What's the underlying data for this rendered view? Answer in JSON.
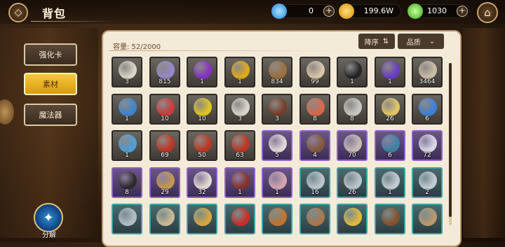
{
  "header": {
    "title": "背包"
  },
  "resources": [
    {
      "name": "blue-gem",
      "value": "0",
      "color": "#3fb3ff"
    },
    {
      "name": "gold-coin",
      "value": "199.6W",
      "color": "#f2b21d"
    },
    {
      "name": "green-crystal",
      "value": "1030",
      "color": "#5fd13b"
    }
  ],
  "tabs": [
    {
      "label": "强化卡",
      "active": false
    },
    {
      "label": "素材",
      "active": true
    },
    {
      "label": "魔法器",
      "active": false
    }
  ],
  "decompose_label": "分解",
  "inventory": {
    "capacity": "容量: 52/2000",
    "sort_label": "降序",
    "sort_icon": "⇅",
    "quality_label": "品质",
    "quality_icon": "⌄",
    "rows": [
      [
        {
          "icon": "feather-icon",
          "rarity": "gray",
          "count": "3",
          "color": "#e9e3d6"
        },
        {
          "icon": "ticket-icon",
          "rarity": "gray",
          "count": "815",
          "color": "#9c8fd8"
        },
        {
          "icon": "purple-feather-icon",
          "rarity": "gray",
          "count": "1",
          "color": "#8b2fd0"
        },
        {
          "icon": "golden-feather-icon",
          "rarity": "gray",
          "count": "1",
          "color": "#f0b418"
        },
        {
          "icon": "potato-icon",
          "rarity": "gray",
          "count": "834",
          "color": "#a5743c"
        },
        {
          "icon": "scroll-icon",
          "rarity": "gray",
          "count": "99",
          "color": "#e8d2b4"
        },
        {
          "icon": "ink-bottle-icon",
          "rarity": "gray",
          "count": "1",
          "color": "#1f1f24"
        },
        {
          "icon": "purple-crystal-icon",
          "rarity": "gray",
          "count": "1",
          "color": "#6a3ad0"
        },
        {
          "icon": "bottle-icon",
          "rarity": "gray",
          "count": "3464",
          "color": "#d8c8b0"
        }
      ],
      [
        {
          "icon": "blue-stars-icon",
          "rarity": "gray",
          "count": "1",
          "color": "#3a8ce0"
        },
        {
          "icon": "red-stars-icon",
          "rarity": "gray",
          "count": "10",
          "color": "#d83a3a"
        },
        {
          "icon": "yellow-stars-icon",
          "rarity": "gray",
          "count": "10",
          "color": "#f0d21c"
        },
        {
          "icon": "teapot-icon",
          "rarity": "gray",
          "count": "3",
          "color": "#e8e2da"
        },
        {
          "icon": "slingshot-icon",
          "rarity": "gray",
          "count": "3",
          "color": "#7a3a24"
        },
        {
          "icon": "cake-icon",
          "rarity": "gray",
          "count": "8",
          "color": "#e86a4a"
        },
        {
          "icon": "jar-icon",
          "rarity": "gray",
          "count": "8",
          "color": "#d6d4d0"
        },
        {
          "icon": "pudding-icon",
          "rarity": "gray",
          "count": "26",
          "color": "#f2d26a"
        },
        {
          "icon": "blue-potion-icon",
          "rarity": "gray",
          "count": "6",
          "color": "#3a86e8"
        }
      ],
      [
        {
          "icon": "potion-vial-icon",
          "rarity": "gray",
          "count": "1",
          "color": "#4aa8e8"
        },
        {
          "icon": "treasure-chest-icon",
          "rarity": "gray",
          "count": "69",
          "color": "#c8321e"
        },
        {
          "icon": "treasure-chest-icon",
          "rarity": "gray",
          "count": "50",
          "color": "#c8321e"
        },
        {
          "icon": "treasure-chest-icon",
          "rarity": "gray",
          "count": "63",
          "color": "#c8321e"
        },
        {
          "icon": "sake-bottle-icon",
          "rarity": "purple",
          "count": "5",
          "color": "#f0e8e0"
        },
        {
          "icon": "wooden-club-icon",
          "rarity": "purple",
          "count": "4",
          "color": "#8a5a34"
        },
        {
          "icon": "flask-icon",
          "rarity": "purple",
          "count": "70",
          "color": "#d4c8bc"
        },
        {
          "icon": "book-icon",
          "rarity": "purple",
          "count": "6",
          "color": "#3a8aa8"
        },
        {
          "icon": "ribbon-icon",
          "rarity": "purple",
          "count": "72",
          "color": "#e8e8f4"
        }
      ],
      [
        {
          "icon": "black-book-icon",
          "rarity": "purple",
          "count": "8",
          "color": "#2a2624"
        },
        {
          "icon": "sandwich-icon",
          "rarity": "purple",
          "count": "29",
          "color": "#d0a050"
        },
        {
          "icon": "milk-jar-icon",
          "rarity": "purple",
          "count": "32",
          "color": "#f0eadc"
        },
        {
          "icon": "meat-icon",
          "rarity": "purple",
          "count": "1",
          "color": "#8a3024"
        },
        {
          "icon": "letter-icon",
          "rarity": "purple",
          "count": "1",
          "color": "#e0b0b4"
        },
        {
          "icon": "silver-staff-icon",
          "rarity": "teal",
          "count": "16",
          "color": "#c8d0d8"
        },
        {
          "icon": "silver-staff-icon",
          "rarity": "teal",
          "count": "26",
          "color": "#c8d0d8"
        },
        {
          "icon": "silver-wand-icon",
          "rarity": "teal",
          "count": "1",
          "color": "#d0d8e0"
        },
        {
          "icon": "silver-scepter-icon",
          "rarity": "teal",
          "count": "2",
          "color": "#d0d8e0"
        }
      ],
      [
        {
          "icon": "silver-key-icon",
          "rarity": "teal",
          "count": "",
          "color": "#c0c8d0"
        },
        {
          "icon": "parchment-icon",
          "rarity": "teal",
          "count": "",
          "color": "#d8c49a"
        },
        {
          "icon": "flower-bouquet-icon",
          "rarity": "teal",
          "count": "",
          "color": "#e8b040"
        },
        {
          "icon": "apple-icon",
          "rarity": "teal",
          "count": "",
          "color": "#d82a24"
        },
        {
          "icon": "bread-icon",
          "rarity": "teal",
          "count": "",
          "color": "#d0782c"
        },
        {
          "icon": "mushroom-icon",
          "rarity": "teal",
          "count": "",
          "color": "#b87a4a"
        },
        {
          "icon": "fried-egg-icon",
          "rarity": "teal",
          "count": "",
          "color": "#f2c43a"
        },
        {
          "icon": "cookie-icon",
          "rarity": "teal",
          "count": "",
          "color": "#8a5026"
        },
        {
          "icon": "pouch-icon",
          "rarity": "teal",
          "count": "",
          "color": "#c8a070"
        }
      ]
    ]
  }
}
